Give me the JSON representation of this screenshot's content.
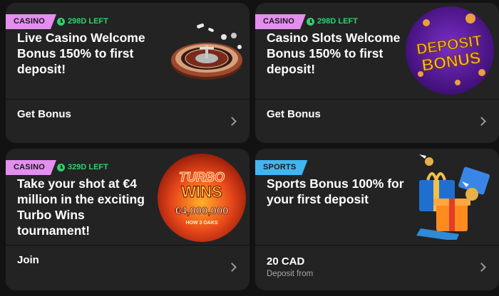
{
  "colors": {
    "casino_tag": "#e48ef0",
    "sports_tag": "#3fb6f2",
    "timer_green": "#2fd06f",
    "card_bg": "#232323",
    "page_bg": "#121212"
  },
  "cards": [
    {
      "tag": "CASINO",
      "timer": "298D LEFT",
      "title_lines": [
        "Live Casino Welcome",
        "Bonus 150% to first",
        "deposit!"
      ],
      "action": "Get Bonus",
      "image": "roulette-wheel-icon"
    },
    {
      "tag": "CASINO",
      "timer": "298D LEFT",
      "title_lines": [
        "Casino Slots Welcome",
        "Bonus 150% to first",
        "deposit!"
      ],
      "action": "Get Bonus",
      "image": "deposit-bonus-badge",
      "image_text": [
        "DEPOSIT",
        "BONUS"
      ]
    },
    {
      "tag": "CASINO",
      "timer": "329D LEFT",
      "title_lines": [
        "Take your shot at €4",
        "million in the exciting",
        "Turbo Wins",
        "tournament!"
      ],
      "action": "Join",
      "image": "turbo-wins-badge",
      "image_text": [
        "TURBO",
        "WINS",
        "€4,000,000",
        "HOW 3 OAKS"
      ]
    },
    {
      "tag": "SPORTS",
      "title_lines": [
        "Sports Bonus 100% for",
        "your first deposit"
      ],
      "action": "20 CAD",
      "action_sub": "Deposit from",
      "image": "gift-boxes-icon"
    }
  ]
}
